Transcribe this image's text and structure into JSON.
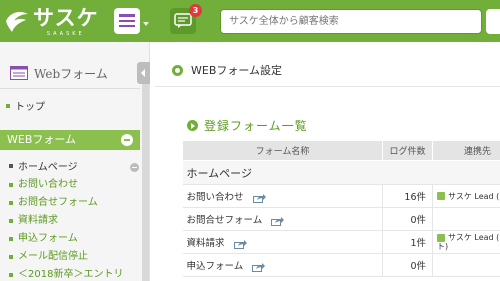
{
  "header": {
    "logo_text": "サスケ",
    "logo_sub": "SAASKE",
    "notification_count": "3",
    "search_placeholder": "サスケ全体から顧客検索",
    "brand_color": "#72ae3a"
  },
  "sidebar": {
    "title": "Webフォーム",
    "top_link": "トップ",
    "section_label": "WEBフォーム",
    "sub_label": "ホームページ",
    "items": [
      "お問い合わせ",
      "お問合せフォーム",
      "資料請求",
      "申込フォーム",
      "メール配信停止",
      "＜2018新卒＞エントリ"
    ]
  },
  "main": {
    "page_title": "WEBフォーム設定",
    "section_title": "登録フォーム一覧",
    "table": {
      "columns": [
        "フォーム名称",
        "ログ件数",
        "連携先"
      ],
      "group": "ホームページ",
      "rows": [
        {
          "name": "お問い合わせ",
          "count": "16件",
          "link": "サスケ Lead (ス"
        },
        {
          "name": "お問合せフォーム",
          "count": "0件",
          "link": ""
        },
        {
          "name": "資料請求",
          "count": "1件",
          "link": "サスケ Lead (ストト)"
        },
        {
          "name": "申込フォーム",
          "count": "0件",
          "link": ""
        }
      ]
    }
  }
}
